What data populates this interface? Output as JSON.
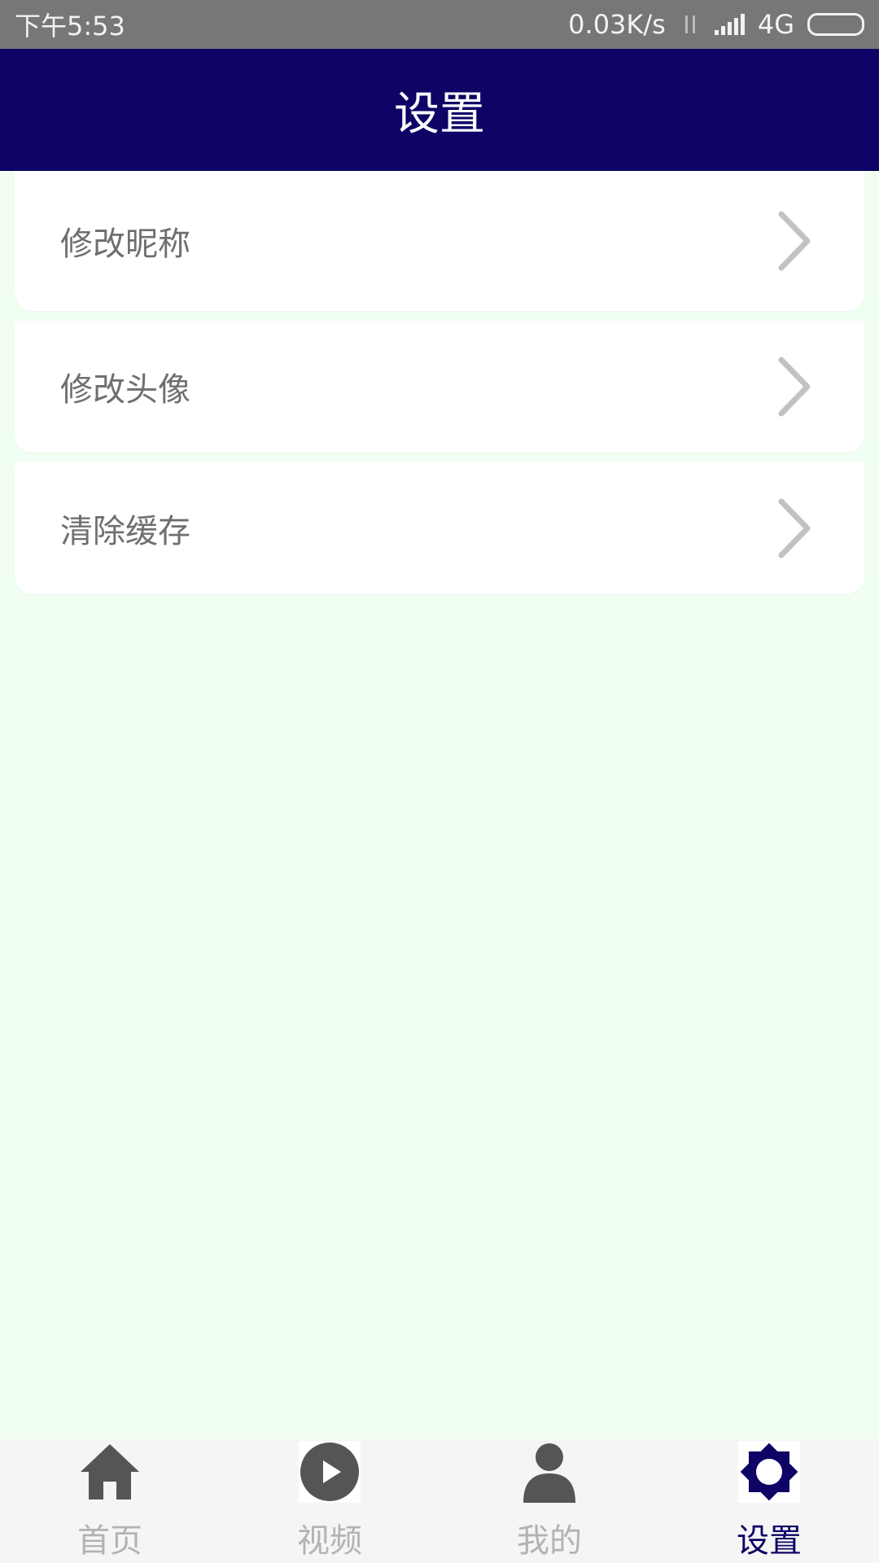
{
  "status_bar": {
    "time": "下午5:53",
    "network_speed": "0.03K/s",
    "network_type": "4G",
    "icons": [
      "data-arrows-icon",
      "signal-icon",
      "battery-icon"
    ]
  },
  "header": {
    "title": "设置"
  },
  "settings": {
    "items": [
      {
        "label": "修改昵称",
        "icon": "chevron-right-icon"
      },
      {
        "label": "修改头像",
        "icon": "chevron-right-icon"
      },
      {
        "label": "清除缓存",
        "icon": "chevron-right-icon"
      }
    ]
  },
  "bottom_nav": {
    "active_index": 3,
    "items": [
      {
        "label": "首页",
        "icon": "home-icon"
      },
      {
        "label": "视频",
        "icon": "play-icon"
      },
      {
        "label": "我的",
        "icon": "user-icon"
      },
      {
        "label": "设置",
        "icon": "gear-icon"
      }
    ]
  },
  "colors": {
    "header_bg": "#0e0466",
    "status_bar_bg": "#777777",
    "page_bg": "#f0fff2",
    "nav_active": "#0e0466",
    "nav_inactive": "#b3b3b3",
    "icon_inactive": "#555555"
  }
}
